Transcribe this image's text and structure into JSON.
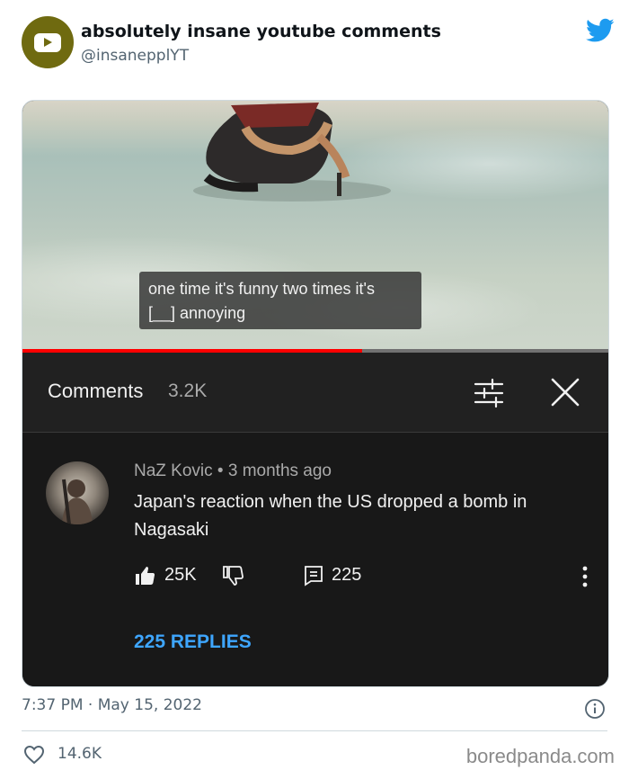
{
  "tweet": {
    "display_name": "absolutely insane youtube comments",
    "handle": "@insanepplYT",
    "timestamp": "7:37 PM · May 15, 2022",
    "likes": "14.6K",
    "avatar_bg": "#6f6a10",
    "brand_color": "#1d9bf0"
  },
  "video": {
    "caption_line1": "one time it's funny two times it's",
    "caption_line2": "[__] annoying",
    "progress_fraction": 0.58,
    "progress_color": "#ff0000"
  },
  "comments_panel": {
    "title": "Comments",
    "count": "3.2K",
    "icons": [
      "filter-icon",
      "close-icon"
    ]
  },
  "comment": {
    "author": "NaZ Kovic",
    "age": "3 months ago",
    "text_line1": "Japan's reaction when the  US dropped a bomb in",
    "text_line2": "Nagasaki",
    "likes": "25K",
    "replies_count": "225",
    "replies_link": "225 REPLIES",
    "link_color": "#3ea6ff"
  },
  "footer": {
    "watermark": "boredpanda.com"
  }
}
